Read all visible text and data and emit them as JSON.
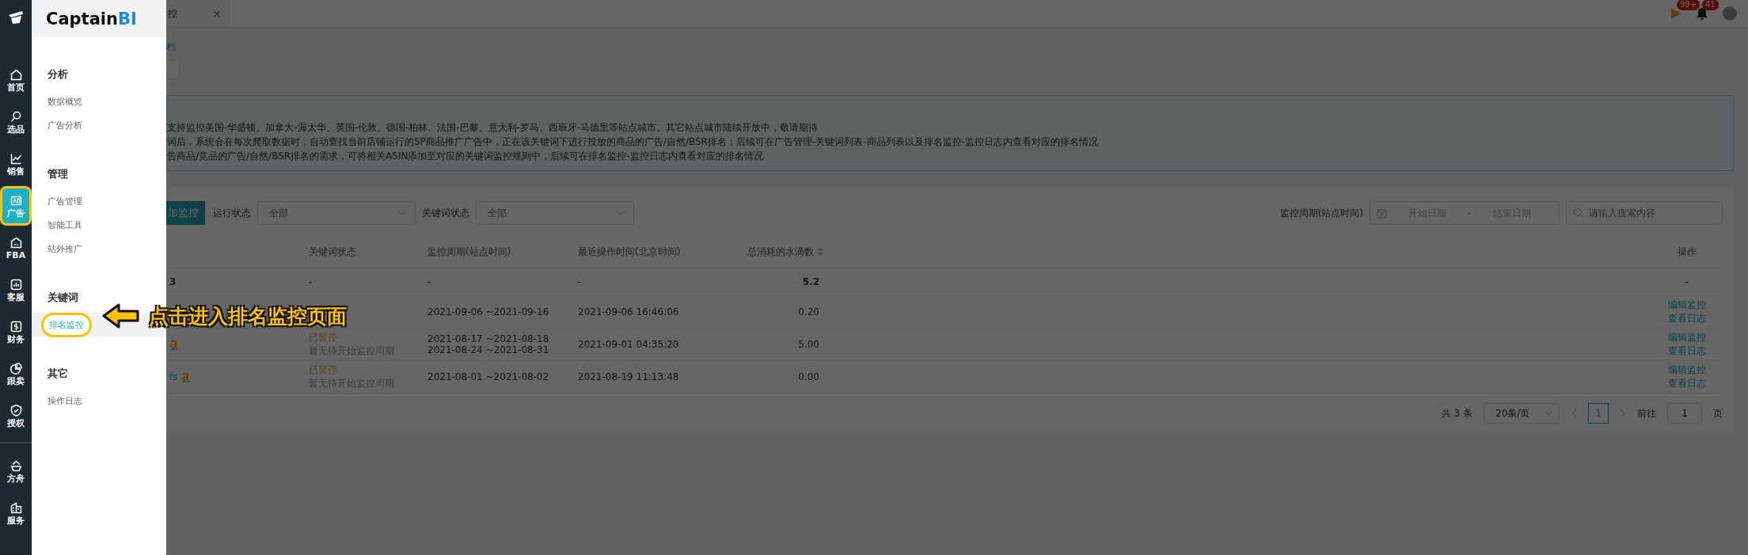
{
  "rail": {
    "items": [
      {
        "label": "首页",
        "selected": false,
        "highlighted": false
      },
      {
        "label": "选品",
        "selected": false,
        "highlighted": false
      },
      {
        "label": "销售",
        "selected": false,
        "highlighted": false
      },
      {
        "label": "广告",
        "selected": true,
        "highlighted": true
      },
      {
        "label": "FBA",
        "selected": false,
        "highlighted": false
      },
      {
        "label": "客服",
        "selected": false,
        "highlighted": false
      },
      {
        "label": "财务",
        "selected": false,
        "highlighted": false
      },
      {
        "label": "跟卖",
        "selected": false,
        "highlighted": false
      },
      {
        "label": "授权",
        "selected": false,
        "highlighted": false
      }
    ],
    "bottom_items": [
      {
        "label": "方舟",
        "selected": false,
        "highlighted": false
      },
      {
        "label": "服务",
        "selected": false,
        "highlighted": false
      }
    ]
  },
  "menu": {
    "logo": {
      "text": "Captain",
      "accent": "BI"
    },
    "groups": [
      {
        "title": "分析",
        "items": [
          {
            "label": "数据概览",
            "selected": false,
            "highlighted": false
          },
          {
            "label": "广告分析",
            "selected": false,
            "highlighted": false
          }
        ]
      },
      {
        "title": "管理",
        "items": [
          {
            "label": "广告管理",
            "selected": false,
            "highlighted": false
          },
          {
            "label": "智能工具",
            "selected": false,
            "highlighted": false
          },
          {
            "label": "站外推广",
            "selected": false,
            "highlighted": false
          }
        ]
      },
      {
        "title": "关键词",
        "items": [
          {
            "label": "排名监控",
            "selected": true,
            "highlighted": true
          }
        ]
      },
      {
        "title": "其它",
        "items": [
          {
            "label": "操作日志",
            "selected": false,
            "highlighted": false
          }
        ]
      }
    ]
  },
  "callout": {
    "text": "点击进入排名监控页面"
  },
  "topbar": {
    "tab": {
      "label": "控",
      "close": "×"
    },
    "flag_badge": "99+",
    "bell_badge": "41"
  },
  "link": "档",
  "notice": {
    "lines": [
      "支持监控美国-华盛顿、加拿大-渥太华、英国-伦敦、德国-柏林、法国-巴黎、意大利-罗马、西班牙-马德里等站点城市。其它站点城市陆续开放中，敬请期待",
      "词后，系统会在每次爬取数据时，自动查找当前店铺运行的SP商品推广广告中，正在该关键词下进行投放的商品的广告/自然/BSR排名；后续可在广告管理-关键词列表-商品列表以及排名监控-监控日志内查看对应的排名情况",
      "告商品/竞品的广告/自然/BSR排名的需求，可将相关ASIN添加至对应的关键词监控规则中，后续可在排名监控-监控日志内查看对应的排名情况"
    ]
  },
  "toolbar": {
    "add_button": "加监控",
    "run_status": {
      "label": "运行状态",
      "value": "全部"
    },
    "keyword_status": {
      "label": "关键词状态",
      "value": "全部"
    },
    "period_label": "监控周期(站点时间)",
    "start_placeholder": "开始日期",
    "range_sep": "-",
    "end_placeholder": "结束日期",
    "search_placeholder": "请输入搜索内容"
  },
  "table": {
    "columns": [
      "关键词状态",
      "监控周期(站点时间)",
      "最近操作时间(北京时间)",
      "总消耗的水滴数",
      "操作"
    ],
    "total_row": {
      "name": "3",
      "status": "-",
      "period": "-",
      "last_op": "-",
      "drops": "5.2",
      "action": "-"
    },
    "rows": [
      {
        "periods": [
          "2021-09-06 ~2021-09-16"
        ],
        "last_op": "2021-09-06 16:46:06",
        "drops": "0.20",
        "actions": [
          "编辑监控",
          "查看日志"
        ]
      },
      {
        "amazon": true,
        "status": "已暂停",
        "note": "暂无待开始监控周期",
        "periods": [
          "2021-08-17 ~2021-08-18",
          "2021-08-24 ~2021-08-31"
        ],
        "last_op": "2021-09-01 04:35:20",
        "drops": "5.00",
        "actions": [
          "编辑监控",
          "查看日志"
        ]
      },
      {
        "name": "fs",
        "amazon": true,
        "status": "已暂停",
        "note": "暂无待开始监控周期",
        "periods": [
          "2021-08-01 ~2021-08-02"
        ],
        "last_op": "2021-08-19 11:13:48",
        "drops": "0.00",
        "actions": [
          "编辑监控",
          "查看日志"
        ]
      }
    ]
  },
  "pagination": {
    "total": "共 3 条",
    "page_size": "20条/页",
    "pages": [
      {
        "label": "1",
        "selected": true
      }
    ],
    "goto_label": "前往",
    "goto_value": "1",
    "goto_suffix": "页"
  }
}
